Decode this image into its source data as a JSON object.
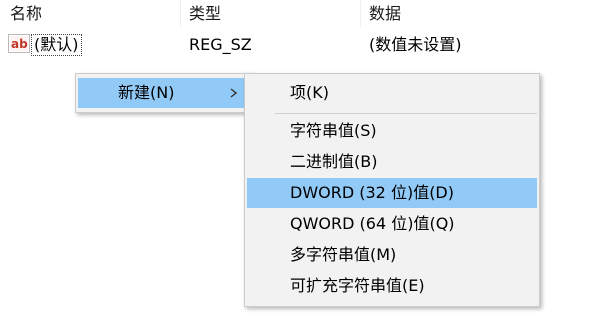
{
  "list": {
    "columns": {
      "name": "名称",
      "type": "类型",
      "data": "数据"
    },
    "rows": [
      {
        "icon": "string-value-ab-icon",
        "name": "(默认)",
        "type": "REG_SZ",
        "data": "(数值未设置)"
      }
    ]
  },
  "context_menu": {
    "new_item": {
      "label": "新建(N)",
      "arrow_icon": "chevron-right-icon"
    },
    "submenu": {
      "key": "项(K)",
      "string_value": "字符串值(S)",
      "binary_value": "二进制值(B)",
      "dword_value": "DWORD (32 位)值(D)",
      "qword_value": "QWORD (64 位)值(Q)",
      "multi_string_value": "多字符串值(M)",
      "expandable_string_value": "可扩充字符串值(E)"
    },
    "highlighted": [
      "new_item",
      "dword_value"
    ]
  },
  "colors": {
    "menu_background": "#f2f2f2",
    "highlight": "#91c9f7",
    "ab_icon_red": "#c0392b"
  }
}
